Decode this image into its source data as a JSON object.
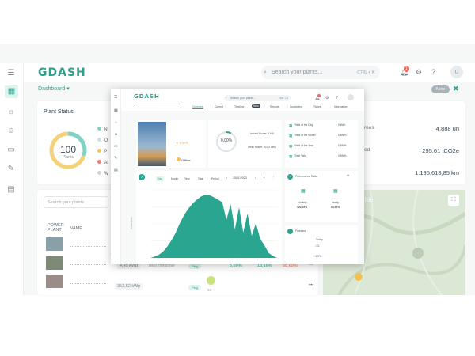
{
  "brand": {
    "logo": "GDASH",
    "accent": "#2aa58f"
  },
  "topbar": {
    "search_placeholder": "Search your plants...",
    "shortcut": "CTRL + K",
    "notification_count": "1",
    "avatar": "U"
  },
  "page": {
    "breadcrumb": "Dashboard",
    "new_button": "New"
  },
  "plant_status": {
    "title": "Plant Status",
    "count": "100",
    "count_label": "Plants",
    "legend": [
      "N",
      "O",
      "P",
      "Al",
      "W"
    ],
    "legend_colors": [
      "#7fd3c4",
      "#c9e4de",
      "#f2c14e",
      "#ef7a6a",
      "#cfd6da"
    ]
  },
  "stats": {
    "rows": [
      {
        "label": "rees",
        "value": "4.888 un"
      },
      {
        "label": "ed",
        "value": "295,61 tCO2e"
      },
      {
        "label": "",
        "value": "1.195.618,85 km"
      }
    ]
  },
  "plants_table": {
    "search_placeholder": "Search your plants...",
    "columns": [
      "POWER PLANT",
      "NAME"
    ],
    "rows": [
      {
        "power": "4,45 kWp",
        "location": "Belo Horizonte",
        "status": "Ping",
        "p1": "5,50%",
        "p2": "18,16%",
        "p3": "58,69%"
      },
      {
        "power": "353,52 kWp",
        "location": "",
        "status": "Ping",
        "p1": "",
        "p2": "",
        "p3": ""
      }
    ],
    "row_extra": "83"
  },
  "overlay": {
    "logo": "GDASH",
    "search_placeholder": "Search your plants...",
    "shortcut": "CTRL + K",
    "tabs": [
      "Overview",
      "Current",
      "Timeline",
      "Reports",
      "Customers",
      "Tickets",
      "Information"
    ],
    "timeline_badge": "New",
    "plant": {
      "capacity": "5.0KS",
      "status": "Offline"
    },
    "gauge": {
      "percent": "0.00%",
      "instant_power": "Instant Power: 0 kW",
      "peak_power": "Peak Power: 90.52 kWp"
    },
    "yields": [
      {
        "label": "Yield of the Day",
        "value": "0 kWh"
      },
      {
        "label": "Yield of the Month",
        "value": "0 MWh"
      },
      {
        "label": "Yield of the Year",
        "value": "0 MWh"
      },
      {
        "label": "Total Yield",
        "value": "0 MWh"
      }
    ],
    "chart_controls": {
      "periods": [
        "Day",
        "Month",
        "Year",
        "Total",
        "Period"
      ],
      "date": "15/11/2023"
    },
    "performance": {
      "title": "Performance Ratio",
      "monthly_label": "Monthly",
      "monthly_value": "120,19%",
      "yearly_label": "Yearly",
      "yearly_value": "94,93%"
    },
    "forecast": {
      "title": "Forecast",
      "day": "Today",
      "temp": "24°C"
    }
  },
  "map": {
    "label": "llite"
  },
  "chart_data": {
    "type": "area",
    "ylabel": "Power (kW)",
    "color": "#2aa58f",
    "x": [
      0,
      1,
      2,
      3,
      4,
      5,
      6,
      7,
      8,
      9,
      10,
      11,
      12,
      13,
      14,
      15,
      16,
      17,
      18,
      19,
      20,
      21,
      22,
      23,
      24,
      25,
      26,
      27,
      28,
      29,
      30
    ],
    "values": [
      0,
      2,
      5,
      10,
      18,
      28,
      40,
      55,
      68,
      78,
      86,
      92,
      97,
      100,
      99,
      96,
      92,
      88,
      60,
      85,
      45,
      80,
      40,
      70,
      35,
      55,
      30,
      20,
      8,
      3,
      0
    ]
  }
}
